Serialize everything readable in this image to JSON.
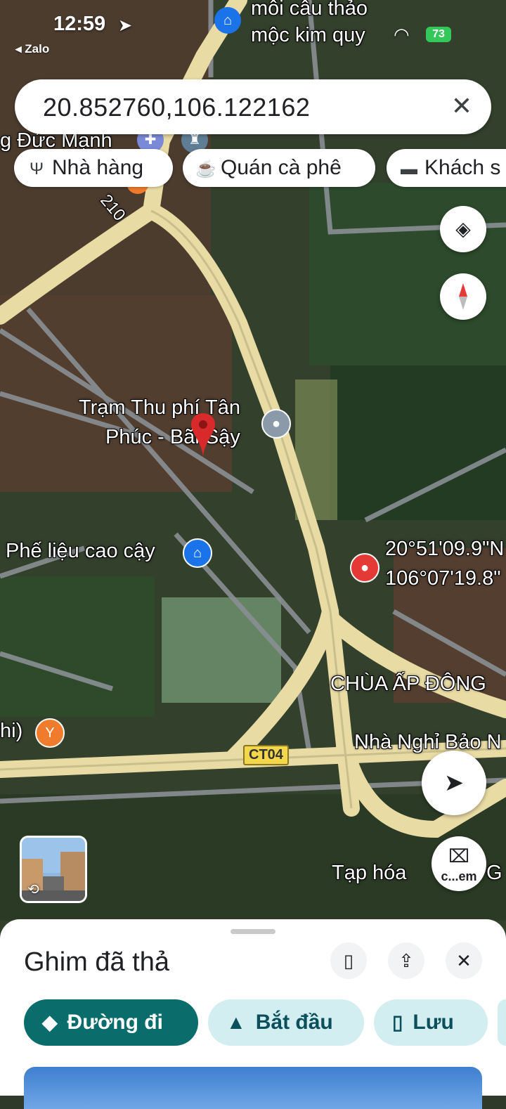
{
  "status_bar": {
    "time": "12:59",
    "back_app": "◂ Zalo",
    "battery": "73"
  },
  "search": {
    "query": "20.852760,106.122162"
  },
  "chips": [
    {
      "icon": "restaurant-icon",
      "label": "Nhà hàng"
    },
    {
      "icon": "coffee-icon",
      "label": "Quán cà phê"
    },
    {
      "icon": "hotel-icon",
      "label": "Khách s"
    }
  ],
  "map_labels": {
    "top_poi_line1": "mỗi câu thảo",
    "top_poi_line2": "mộc kim quy",
    "top_left": "g Đức Mạnh",
    "road_210": "210",
    "toll_line1": "Trạm Thu phí Tân",
    "toll_line2": "Phúc - Bãi Sậy",
    "scrap": "Phế liệu cao cậy",
    "coord_line1": "20°51'09.9\"N",
    "coord_line2": "106°07'19.8\"",
    "temple": "CHÙA ẤP ĐÔNG",
    "left_edge": "hi)",
    "guesthouse": "Nhà Nghỉ Bảo N",
    "grocery": "Tạp hóa",
    "grocery_end": "G",
    "shield_ct04": "CT04",
    "camera_label": "c...em"
  },
  "sheet": {
    "title": "Ghim đã thả",
    "actions": [
      {
        "icon": "directions-icon",
        "label": "Đường đi"
      },
      {
        "icon": "navigation-arrow-icon",
        "label": "Bắt đầu"
      },
      {
        "icon": "bookmark-icon",
        "label": "Lưu"
      }
    ]
  },
  "colors": {
    "accent_teal": "#0b6c6c",
    "action_pale": "#d3eef0",
    "road": "#e9dba4",
    "pin_red": "#d82a2a"
  }
}
